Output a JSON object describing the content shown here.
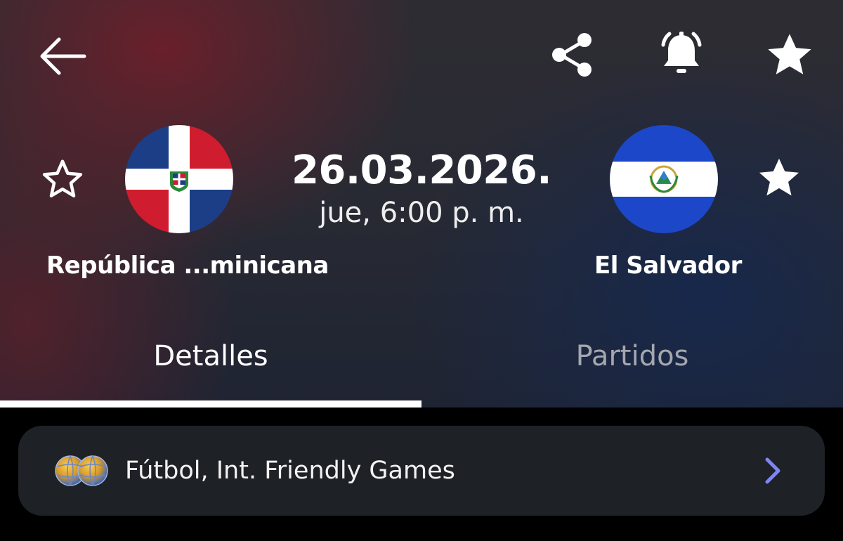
{
  "header": {
    "back_icon": "arrow-left-icon",
    "share_icon": "share-icon",
    "alert_icon": "bell-ringing-icon",
    "favorite_icon": "star-filled-icon"
  },
  "match": {
    "date": "26.03.2026.",
    "time": "jue, 6:00 p. m.",
    "home_team": {
      "name": "República ...minicana",
      "favorite_icon": "star-outline-icon",
      "flag_icon": "dominican-republic-flag-icon"
    },
    "away_team": {
      "name": "El Salvador",
      "favorite_icon": "star-filled-icon",
      "flag_icon": "el-salvador-flag-icon"
    }
  },
  "tabs": [
    {
      "label": "Detalles",
      "active": true
    },
    {
      "label": "Partidos",
      "active": false
    }
  ],
  "league": {
    "name": "Fútbol, Int. Friendly Games",
    "icon": "world-globes-icon",
    "arrow_icon": "chevron-right-icon"
  },
  "colors": {
    "tab_inactive": "#a4a7ae",
    "card_background": "#1e2125",
    "chevron": "#7f86ee",
    "dr_blue": "#1b3e86",
    "dr_red": "#cf1d2f",
    "sv_blue": "#1c47c8"
  }
}
